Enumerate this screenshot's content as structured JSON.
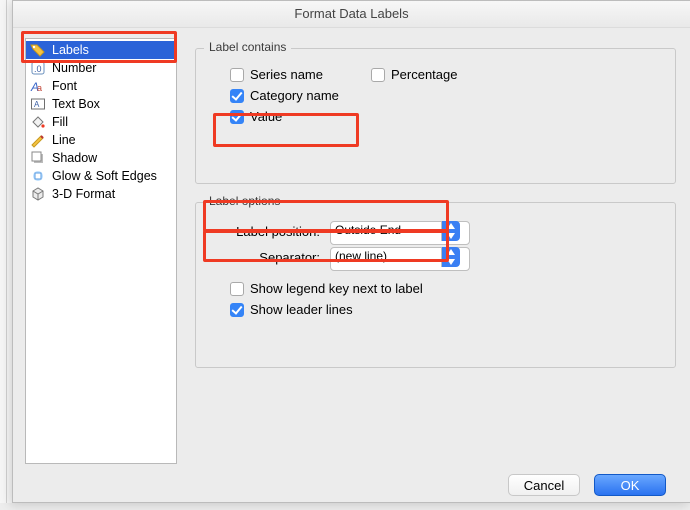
{
  "window": {
    "title": "Format Data Labels"
  },
  "sidebar": {
    "items": [
      {
        "label": "Labels",
        "selected": true
      },
      {
        "label": "Number"
      },
      {
        "label": "Font"
      },
      {
        "label": "Text Box"
      },
      {
        "label": "Fill"
      },
      {
        "label": "Line"
      },
      {
        "label": "Shadow"
      },
      {
        "label": "Glow & Soft Edges"
      },
      {
        "label": "3-D Format"
      }
    ]
  },
  "labelContains": {
    "legend": "Label contains",
    "seriesName": {
      "label": "Series name",
      "checked": false
    },
    "percentage": {
      "label": "Percentage",
      "checked": false
    },
    "categoryName": {
      "label": "Category name",
      "checked": true
    },
    "value": {
      "label": "Value",
      "checked": true
    }
  },
  "labelOptions": {
    "legend": "Label options",
    "position": {
      "label": "Label position:",
      "value": "Outside End"
    },
    "separator": {
      "label": "Separator:",
      "value": "(new line)"
    },
    "legendKey": {
      "label": "Show legend key next to label",
      "checked": false
    },
    "leaderLines": {
      "label": "Show leader lines",
      "checked": true
    }
  },
  "buttons": {
    "cancel": "Cancel",
    "ok": "OK"
  }
}
